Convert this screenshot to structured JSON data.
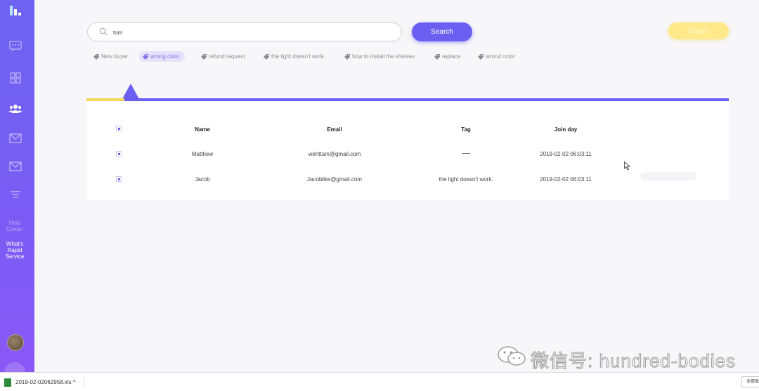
{
  "sidebar": {
    "help_label": "Help Center",
    "whats_label": "What's Rapid Service"
  },
  "search": {
    "value": "tom",
    "button_label": "Search"
  },
  "export_label": "Export",
  "tags": [
    {
      "label": "New buyer"
    },
    {
      "label": "wrong color",
      "active": true
    },
    {
      "label": "refund request"
    },
    {
      "label": "the light doesn't work."
    },
    {
      "label": "how to install the shelves"
    },
    {
      "label": "replace"
    },
    {
      "label": "wrond color"
    }
  ],
  "table": {
    "headers": {
      "name": "Name",
      "email": "Email",
      "tag": "Tag",
      "join_day": "Join day"
    },
    "rows": [
      {
        "name": "Matthew",
        "email": "wehttam@gmail.com",
        "tag": "",
        "join_day": "2019-02-02 06:03:11"
      },
      {
        "name": "Jacob",
        "email": "Jacoblike@gmail.com",
        "tag": "the light doesn't work.",
        "join_day": "2019-02-02 06:03:11"
      }
    ]
  },
  "watermark": "微信号: hundred-bodies",
  "download_bar": {
    "file_name": "2019-02-02062958.xls",
    "show_all": "全部显示"
  },
  "colors": {
    "accent": "#6a5ff0",
    "export": "#ffe98a",
    "sidebar_top": "#6d63f0",
    "sidebar_bottom": "#8a58f6"
  }
}
